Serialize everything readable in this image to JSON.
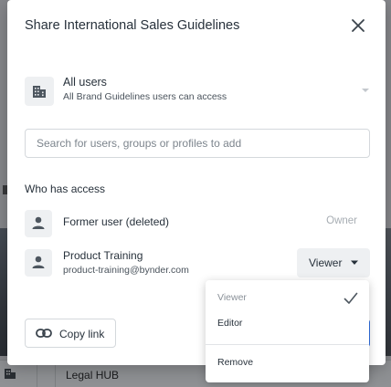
{
  "background": {
    "bottom_bar_label": "Legal HUB"
  },
  "modal": {
    "title": "Share International Sales Guidelines",
    "access": {
      "title": "All users",
      "subtitle": "All Brand Guidelines users can access"
    },
    "search": {
      "placeholder": "Search for users, groups or profiles to add"
    },
    "section_label": "Who has access",
    "people": [
      {
        "name": "Former user (deleted)",
        "email": "",
        "role": "Owner"
      },
      {
        "name": "Product Training",
        "email": "product-training@bynder.com",
        "role": "Viewer"
      }
    ],
    "copy_link_label": "Copy link"
  },
  "dropdown": {
    "items": [
      {
        "label": "Viewer",
        "selected": true
      },
      {
        "label": "Editor",
        "selected": false
      }
    ],
    "remove_label": "Remove"
  },
  "colors": {
    "accent": "#2f6fe4",
    "muted_text": "#a7adb3",
    "tile_bg": "#eef0f2"
  }
}
